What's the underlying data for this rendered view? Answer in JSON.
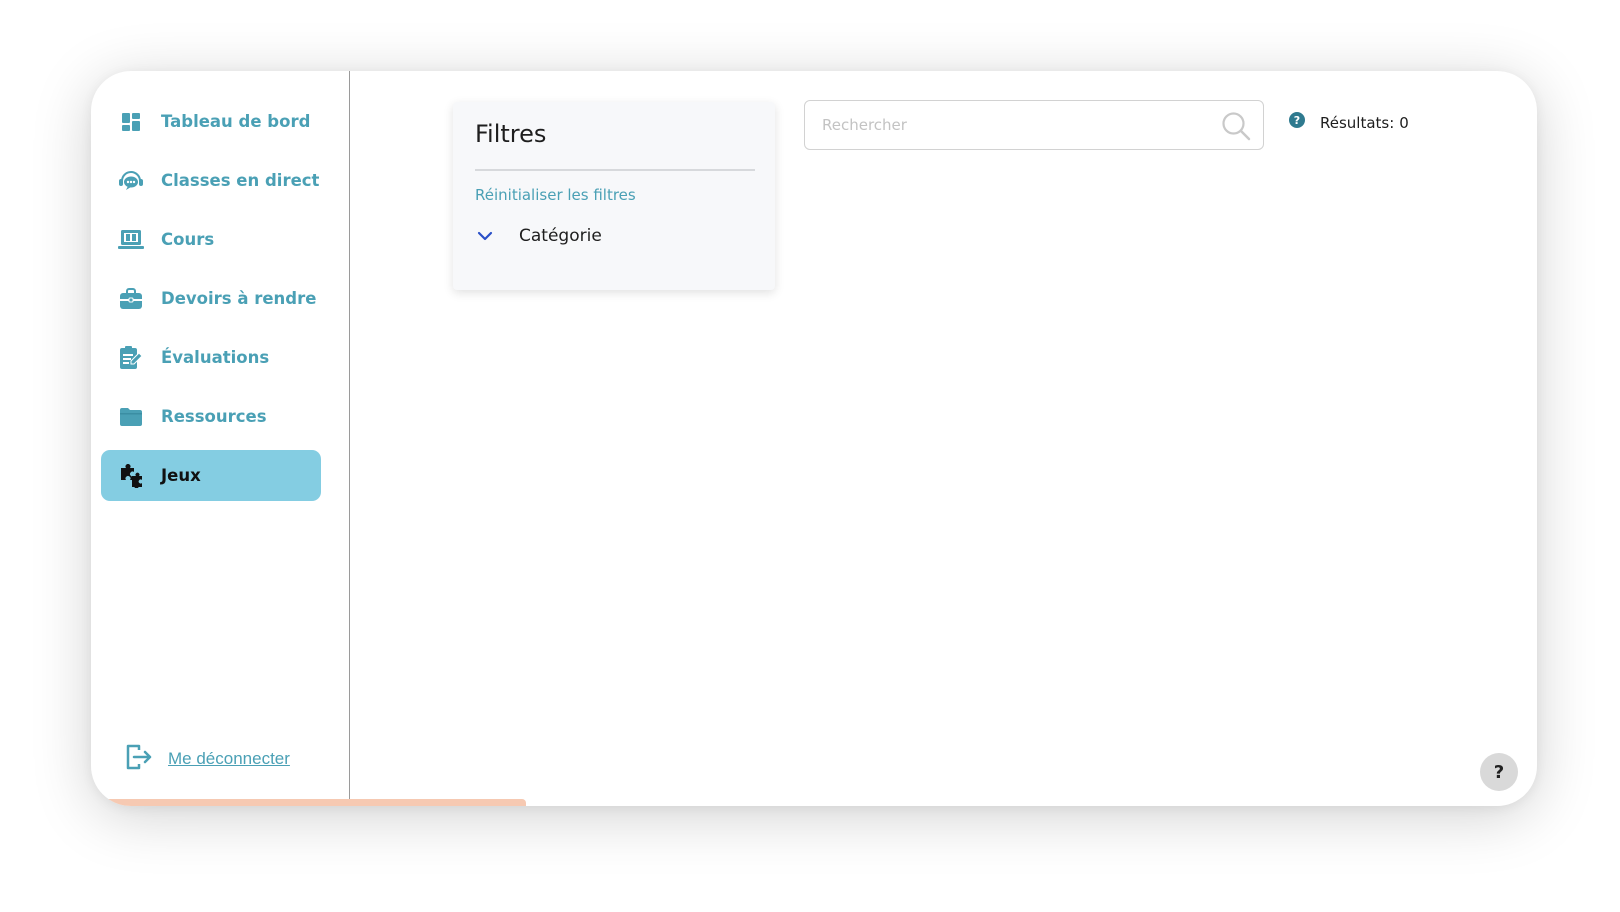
{
  "sidebar": {
    "items": [
      {
        "label": "Tableau de bord",
        "icon": "dashboard-grid-icon",
        "active": false
      },
      {
        "label": "Classes en direct",
        "icon": "headset-chat-icon",
        "active": false
      },
      {
        "label": "Cours",
        "icon": "laptop-book-icon",
        "active": false
      },
      {
        "label": "Devoirs à rendre",
        "icon": "briefcase-icon",
        "active": false
      },
      {
        "label": "Évaluations",
        "icon": "clipboard-pencil-icon",
        "active": false
      },
      {
        "label": "Ressources",
        "icon": "folder-icon",
        "active": false
      },
      {
        "label": "Jeux",
        "icon": "puzzle-pieces-icon",
        "active": true
      }
    ],
    "logout_label": "Me déconnecter"
  },
  "filters": {
    "title": "Filtres",
    "reset_label": "Réinitialiser les filtres",
    "category_label": "Catégorie"
  },
  "search": {
    "placeholder": "Rechercher",
    "value": ""
  },
  "results": {
    "label": "Résultats:",
    "count": "0"
  },
  "help_button": {
    "label": "?"
  },
  "colors": {
    "accent": "#4aa0b5",
    "active_bg": "#84cde2",
    "chevron": "#2a50c8"
  }
}
